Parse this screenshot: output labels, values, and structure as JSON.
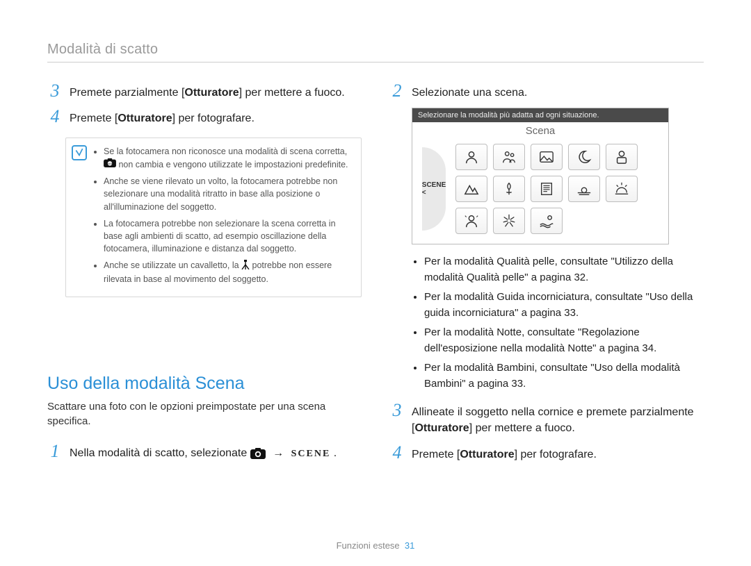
{
  "header": {
    "title": "Modalità di scatto"
  },
  "left": {
    "steps": {
      "s3": {
        "num": "3",
        "pre": "Premete parzialmente [",
        "bold": "Otturatore",
        "post": "] per mettere a fuoco."
      },
      "s4": {
        "num": "4",
        "pre": "Premete [",
        "bold": "Otturatore",
        "post": "] per fotografare."
      }
    },
    "note": {
      "items": [
        "Se la fotocamera non riconosce una modalità di scena corretta, __SMART__ non cambia e vengono utilizzate le impostazioni predefinite.",
        "Anche se viene rilevato un volto, la fotocamera potrebbe non selezionare una modalità ritratto in base alla posizione o all'illuminazione del soggetto.",
        "La fotocamera potrebbe non selezionare la scena corretta in base agli ambienti di scatto, ad esempio oscillazione della fotocamera, illuminazione e distanza dal soggetto.",
        "Anche se utilizzate un cavalletto, la __TRIPOD__ potrebbe non essere rilevata in base al movimento del soggetto."
      ]
    },
    "section": {
      "title": "Uso della modalità Scena",
      "desc": "Scattare una foto con le opzioni preimpostate per una scena specifica.",
      "step1": {
        "num": "1",
        "text": "Nella modalità di scatto, selezionate ",
        "arrow": "→",
        "scene_label": "SCENE",
        "dot": "."
      }
    }
  },
  "right": {
    "step2": {
      "num": "2",
      "text": "Selezionate una scena."
    },
    "scene_shot": {
      "tip": "Selezionare la modalità più adatta ad ogni situazione.",
      "title": "Scena",
      "left_label": "SCENE <",
      "cells": [
        "portrait",
        "children",
        "landscape",
        "night",
        "face",
        "mountain",
        "macro",
        "text",
        "sunset",
        "dawn",
        "backlight",
        "fireworks",
        "beach",
        "",
        ""
      ]
    },
    "bullets": [
      "Per la modalità Qualità pelle, consultate \"Utilizzo della modalità Qualità pelle\" a pagina 32.",
      "Per la modalità Guida incorniciatura, consultate \"Uso della guida incorniciatura\" a pagina 33.",
      "Per la modalità Notte, consultate \"Regolazione dell'esposizione nella modalità Notte\" a pagina 34.",
      "Per la modalità Bambini, consultate \"Uso della modalità Bambini\" a pagina 33."
    ],
    "step3": {
      "num": "3",
      "pre": "Allineate il soggetto nella cornice e premete parzialmente [",
      "bold": "Otturatore",
      "post": "] per mettere a fuoco."
    },
    "step4": {
      "num": "4",
      "pre": "Premete [",
      "bold": "Otturatore",
      "post": "] per fotografare."
    }
  },
  "footer": {
    "label": "Funzioni estese",
    "page": "31"
  }
}
